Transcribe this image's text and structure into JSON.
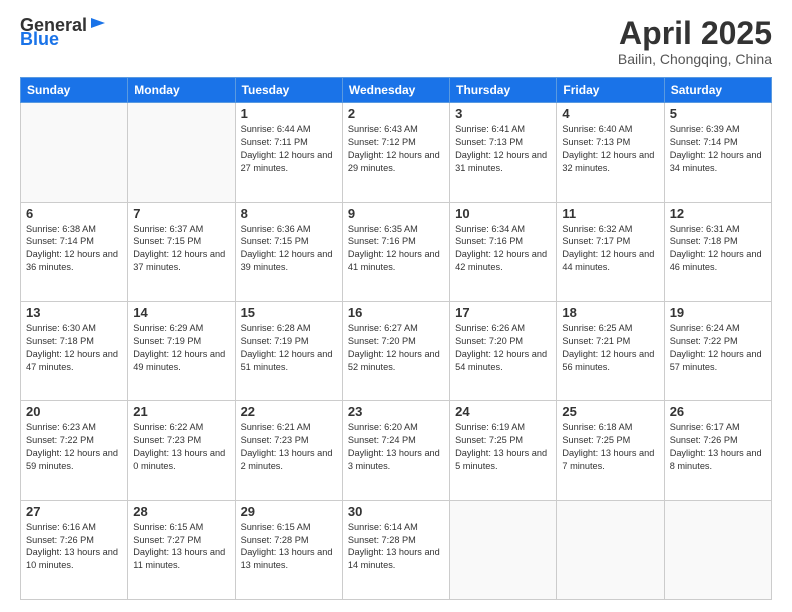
{
  "logo": {
    "text_general": "General",
    "text_blue": "Blue"
  },
  "title": {
    "month_year": "April 2025",
    "location": "Bailin, Chongqing, China"
  },
  "weekdays": [
    "Sunday",
    "Monday",
    "Tuesday",
    "Wednesday",
    "Thursday",
    "Friday",
    "Saturday"
  ],
  "weeks": [
    [
      {
        "day": "",
        "info": ""
      },
      {
        "day": "",
        "info": ""
      },
      {
        "day": "1",
        "info": "Sunrise: 6:44 AM\nSunset: 7:11 PM\nDaylight: 12 hours and 27 minutes."
      },
      {
        "day": "2",
        "info": "Sunrise: 6:43 AM\nSunset: 7:12 PM\nDaylight: 12 hours and 29 minutes."
      },
      {
        "day": "3",
        "info": "Sunrise: 6:41 AM\nSunset: 7:13 PM\nDaylight: 12 hours and 31 minutes."
      },
      {
        "day": "4",
        "info": "Sunrise: 6:40 AM\nSunset: 7:13 PM\nDaylight: 12 hours and 32 minutes."
      },
      {
        "day": "5",
        "info": "Sunrise: 6:39 AM\nSunset: 7:14 PM\nDaylight: 12 hours and 34 minutes."
      }
    ],
    [
      {
        "day": "6",
        "info": "Sunrise: 6:38 AM\nSunset: 7:14 PM\nDaylight: 12 hours and 36 minutes."
      },
      {
        "day": "7",
        "info": "Sunrise: 6:37 AM\nSunset: 7:15 PM\nDaylight: 12 hours and 37 minutes."
      },
      {
        "day": "8",
        "info": "Sunrise: 6:36 AM\nSunset: 7:15 PM\nDaylight: 12 hours and 39 minutes."
      },
      {
        "day": "9",
        "info": "Sunrise: 6:35 AM\nSunset: 7:16 PM\nDaylight: 12 hours and 41 minutes."
      },
      {
        "day": "10",
        "info": "Sunrise: 6:34 AM\nSunset: 7:16 PM\nDaylight: 12 hours and 42 minutes."
      },
      {
        "day": "11",
        "info": "Sunrise: 6:32 AM\nSunset: 7:17 PM\nDaylight: 12 hours and 44 minutes."
      },
      {
        "day": "12",
        "info": "Sunrise: 6:31 AM\nSunset: 7:18 PM\nDaylight: 12 hours and 46 minutes."
      }
    ],
    [
      {
        "day": "13",
        "info": "Sunrise: 6:30 AM\nSunset: 7:18 PM\nDaylight: 12 hours and 47 minutes."
      },
      {
        "day": "14",
        "info": "Sunrise: 6:29 AM\nSunset: 7:19 PM\nDaylight: 12 hours and 49 minutes."
      },
      {
        "day": "15",
        "info": "Sunrise: 6:28 AM\nSunset: 7:19 PM\nDaylight: 12 hours and 51 minutes."
      },
      {
        "day": "16",
        "info": "Sunrise: 6:27 AM\nSunset: 7:20 PM\nDaylight: 12 hours and 52 minutes."
      },
      {
        "day": "17",
        "info": "Sunrise: 6:26 AM\nSunset: 7:20 PM\nDaylight: 12 hours and 54 minutes."
      },
      {
        "day": "18",
        "info": "Sunrise: 6:25 AM\nSunset: 7:21 PM\nDaylight: 12 hours and 56 minutes."
      },
      {
        "day": "19",
        "info": "Sunrise: 6:24 AM\nSunset: 7:22 PM\nDaylight: 12 hours and 57 minutes."
      }
    ],
    [
      {
        "day": "20",
        "info": "Sunrise: 6:23 AM\nSunset: 7:22 PM\nDaylight: 12 hours and 59 minutes."
      },
      {
        "day": "21",
        "info": "Sunrise: 6:22 AM\nSunset: 7:23 PM\nDaylight: 13 hours and 0 minutes."
      },
      {
        "day": "22",
        "info": "Sunrise: 6:21 AM\nSunset: 7:23 PM\nDaylight: 13 hours and 2 minutes."
      },
      {
        "day": "23",
        "info": "Sunrise: 6:20 AM\nSunset: 7:24 PM\nDaylight: 13 hours and 3 minutes."
      },
      {
        "day": "24",
        "info": "Sunrise: 6:19 AM\nSunset: 7:25 PM\nDaylight: 13 hours and 5 minutes."
      },
      {
        "day": "25",
        "info": "Sunrise: 6:18 AM\nSunset: 7:25 PM\nDaylight: 13 hours and 7 minutes."
      },
      {
        "day": "26",
        "info": "Sunrise: 6:17 AM\nSunset: 7:26 PM\nDaylight: 13 hours and 8 minutes."
      }
    ],
    [
      {
        "day": "27",
        "info": "Sunrise: 6:16 AM\nSunset: 7:26 PM\nDaylight: 13 hours and 10 minutes."
      },
      {
        "day": "28",
        "info": "Sunrise: 6:15 AM\nSunset: 7:27 PM\nDaylight: 13 hours and 11 minutes."
      },
      {
        "day": "29",
        "info": "Sunrise: 6:15 AM\nSunset: 7:28 PM\nDaylight: 13 hours and 13 minutes."
      },
      {
        "day": "30",
        "info": "Sunrise: 6:14 AM\nSunset: 7:28 PM\nDaylight: 13 hours and 14 minutes."
      },
      {
        "day": "",
        "info": ""
      },
      {
        "day": "",
        "info": ""
      },
      {
        "day": "",
        "info": ""
      }
    ]
  ]
}
